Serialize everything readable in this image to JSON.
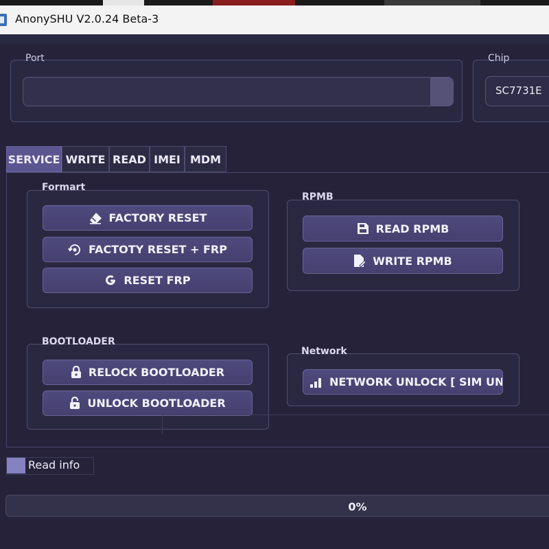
{
  "window": {
    "title": "AnonySHU V2.0.24 Beta-3"
  },
  "port": {
    "label": "Port",
    "value": ""
  },
  "chip": {
    "label": "Chip",
    "value": "SC7731E"
  },
  "tabs": [
    "SERVICE",
    "WRITE",
    "READ",
    "IMEI",
    "MDM"
  ],
  "active_tab": "SERVICE",
  "groups": {
    "format": {
      "label": "Formart",
      "buttons": [
        "FACTORY RESET",
        "FACTOTY RESET + FRP",
        "RESET FRP"
      ],
      "icons": [
        "eraser-icon",
        "reset-eye-icon",
        "google-g-icon"
      ]
    },
    "rpmb": {
      "label": "RPMB",
      "buttons": [
        "READ RPMB",
        "WRITE RPMB"
      ],
      "icons": [
        "save-icon",
        "write-doc-icon"
      ]
    },
    "bootloader": {
      "label": "BOOTLOADER",
      "buttons": [
        "RELOCK BOOTLOADER",
        "UNLOCK BOOTLOADER"
      ],
      "icons": [
        "lock-icon",
        "unlock-icon"
      ]
    },
    "network": {
      "label": "Network",
      "buttons": [
        "NETWORK UNLOCK [ SIM UNLO"
      ],
      "icons": [
        "signal-bars-icon"
      ]
    }
  },
  "read_info": {
    "label": "Read info",
    "checked": true
  },
  "progress": {
    "value": 0,
    "text": "0%"
  },
  "colors": {
    "background": "#25223a",
    "button": "#4a4577",
    "accent": "#5b5590",
    "check": "#8681c1"
  }
}
